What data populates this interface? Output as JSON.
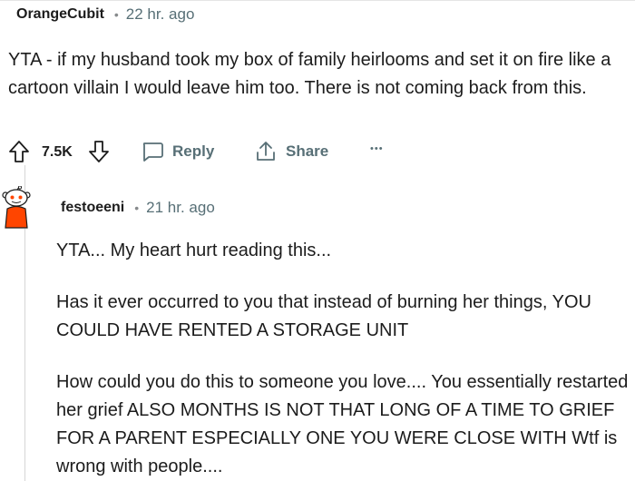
{
  "comment1": {
    "author": "OrangeCubit",
    "separator": "•",
    "time": "22 hr. ago",
    "body": "YTA - if my husband took my box of family heirlooms and set it on fire like a cartoon villain I would leave him too. There is not coming back from this.",
    "actions": {
      "upvote_icon": "upvote-arrow-icon",
      "score": "7.5K",
      "downvote_icon": "downvote-arrow-icon",
      "reply_label": "Reply",
      "share_label": "Share",
      "more_label": "•••"
    }
  },
  "comment2": {
    "author": "festoeeni",
    "separator": "•",
    "time": "21 hr. ago",
    "paragraphs": [
      "YTA... My heart hurt reading this...",
      "Has it ever occurred to you that instead of burning her things, YOU COULD HAVE RENTED A STORAGE UNIT",
      "How could you do this to someone you love.... You essentially restarted her grief ALSO MONTHS IS NOT THAT LONG OF A TIME TO GRIEF FOR A PARENT ESPECIALLY ONE YOU WERE CLOSE WITH Wtf is wrong with people...."
    ]
  },
  "colors": {
    "text": "#1c1c1c",
    "meta": "#576f76",
    "avatar_orange": "#ff4500",
    "thread_line": "#d6d6d6"
  }
}
